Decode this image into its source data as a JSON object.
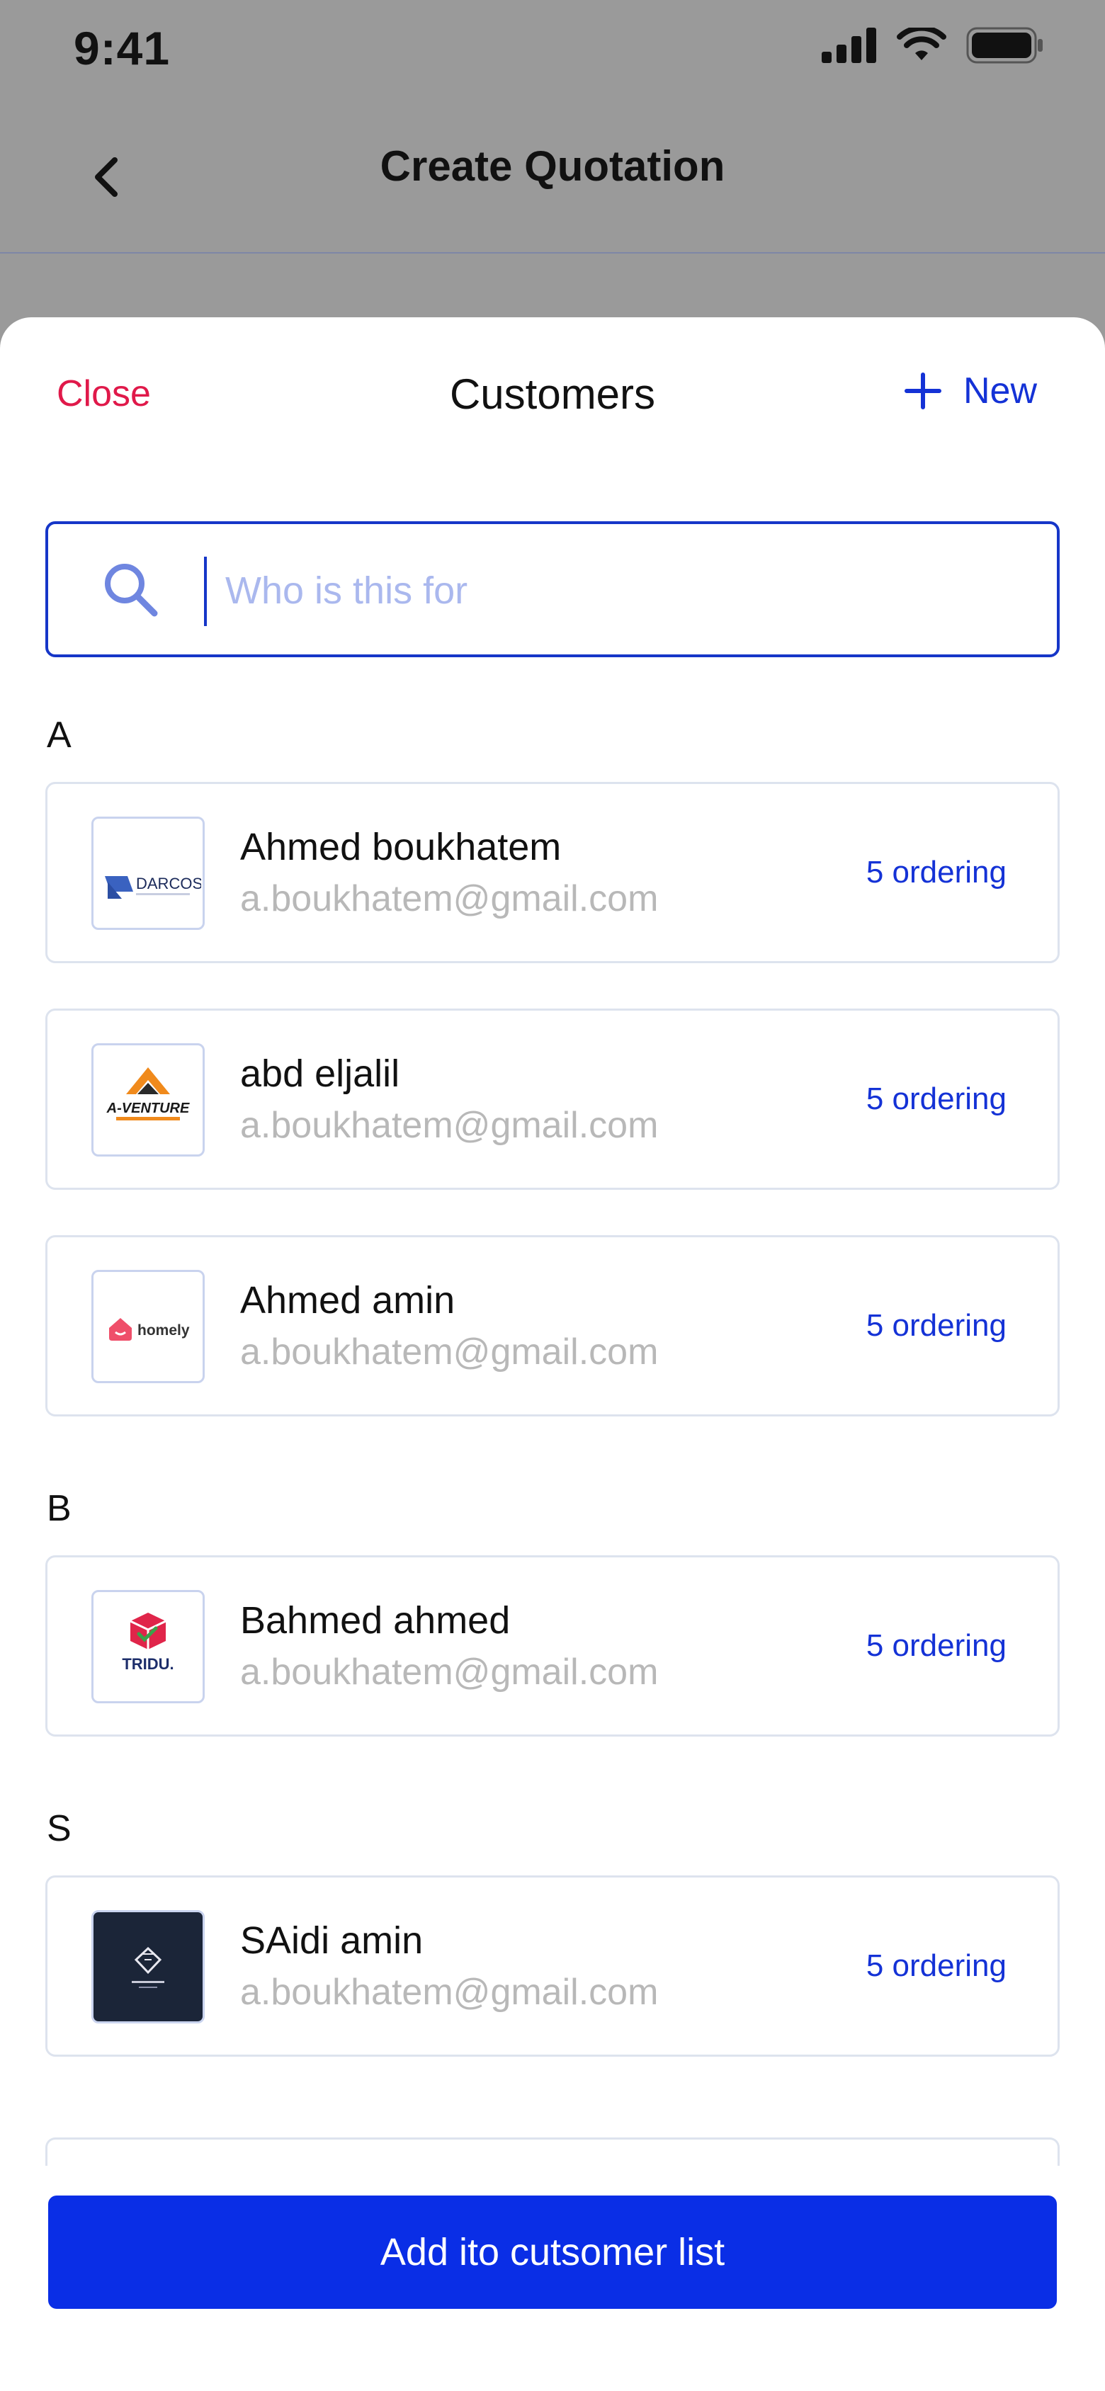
{
  "status": {
    "time": "9:41"
  },
  "nav": {
    "title": "Create Quotation"
  },
  "sheet": {
    "close_label": "Close",
    "title": "Customers",
    "new_label": "New"
  },
  "search": {
    "placeholder": "Who is this for",
    "value": ""
  },
  "sections": [
    {
      "letter": "A"
    },
    {
      "letter": "B"
    },
    {
      "letter": "S"
    }
  ],
  "customers": [
    {
      "name": "Ahmed boukhatem",
      "email": "a.boukhatem@gmail.com",
      "badge": "5 ordering",
      "logo": "darcos-logo",
      "logo_text": "DARCOS"
    },
    {
      "name": "abd eljalil",
      "email": "a.boukhatem@gmail.com",
      "badge": "5 ordering",
      "logo": "a-venture-logo",
      "logo_text": "A-VENTURE"
    },
    {
      "name": "Ahmed amin",
      "email": "a.boukhatem@gmail.com",
      "badge": "5 ordering",
      "logo": "homely-logo",
      "logo_text": "homely"
    },
    {
      "name": "Bahmed ahmed",
      "email": "a.boukhatem@gmail.com",
      "badge": "5 ordering",
      "logo": "tridu-logo",
      "logo_text": "TRIDU."
    },
    {
      "name": "SAidi amin",
      "email": "a.boukhatem@gmail.com",
      "badge": "5 ordering",
      "logo": "diamond-heart-logo",
      "logo_text": ""
    }
  ],
  "footer": {
    "button_label": "Add ito cutsomer list"
  },
  "colors": {
    "accent": "#0a2ee6",
    "danger": "#e0194a",
    "link": "#1432d6"
  }
}
